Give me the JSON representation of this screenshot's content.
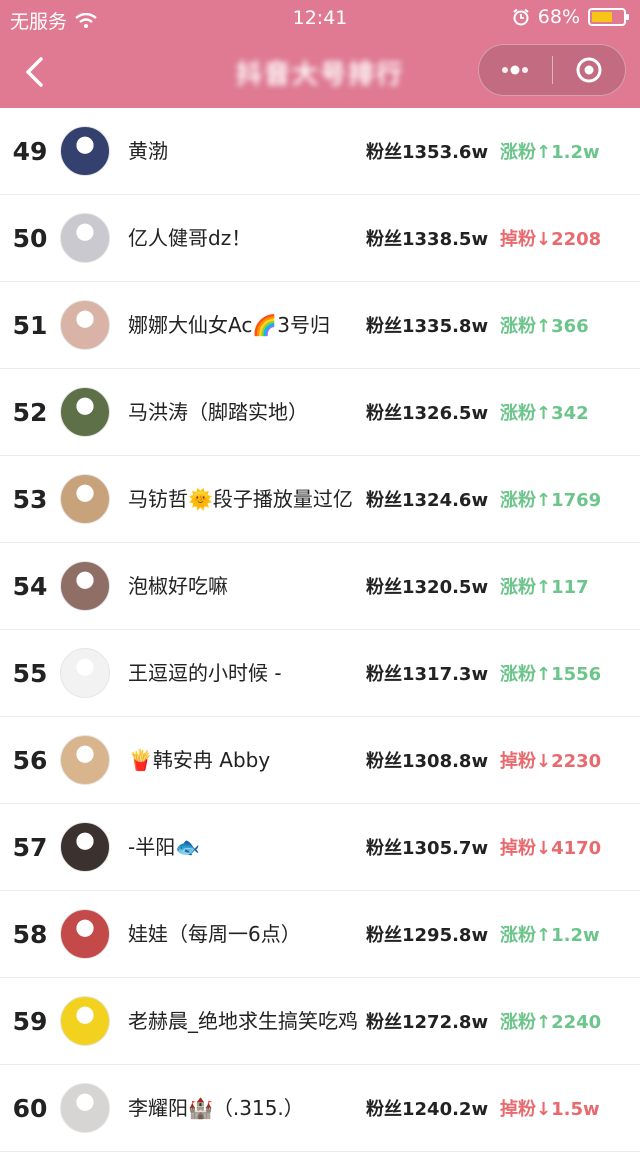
{
  "status": {
    "carrier": "无服务",
    "time": "12:41",
    "battery": "68%"
  },
  "nav": {
    "title": "抖音大号排行",
    "back_icon": "chevron-left-icon"
  },
  "colors": {
    "header": "#df7a92",
    "up": "#6cc58a",
    "down": "#e96a6e"
  },
  "rows": [
    {
      "rank": "49",
      "name": "黄渤",
      "fans": "粉丝1353.6w",
      "change": "涨粉↑1.2w",
      "dir": "up",
      "avatar": "#34406e"
    },
    {
      "rank": "50",
      "name": "亿人健哥dz！",
      "fans": "粉丝1338.5w",
      "change": "掉粉↓2208",
      "dir": "down",
      "avatar": "#c9c9cf"
    },
    {
      "rank": "51",
      "name": "娜娜大仙女Ac🌈3号归",
      "fans": "粉丝1335.8w",
      "change": "涨粉↑366",
      "dir": "up",
      "avatar": "#d8b3a6"
    },
    {
      "rank": "52",
      "name": "马洪涛（脚踏实地）",
      "fans": "粉丝1326.5w",
      "change": "涨粉↑342",
      "dir": "up",
      "avatar": "#5e7048"
    },
    {
      "rank": "53",
      "name": "马钫哲🌞段子播放量过亿",
      "fans": "粉丝1324.6w",
      "change": "涨粉↑1769",
      "dir": "up",
      "avatar": "#c7a27a"
    },
    {
      "rank": "54",
      "name": "泡椒好吃嘛",
      "fans": "粉丝1320.5w",
      "change": "涨粉↑117",
      "dir": "up",
      "avatar": "#8f6e66"
    },
    {
      "rank": "55",
      "name": "王逗逗的小时候 -",
      "fans": "粉丝1317.3w",
      "change": "涨粉↑1556",
      "dir": "up",
      "avatar": "#f2f2f2"
    },
    {
      "rank": "56",
      "name": "🍟韩安冉 Abby",
      "fans": "粉丝1308.8w",
      "change": "掉粉↓2230",
      "dir": "down",
      "avatar": "#d9b58d"
    },
    {
      "rank": "57",
      "name": "-半阳🐟",
      "fans": "粉丝1305.7w",
      "change": "掉粉↓4170",
      "dir": "down",
      "avatar": "#3b3230"
    },
    {
      "rank": "58",
      "name": "娃娃（每周一6点）",
      "fans": "粉丝1295.8w",
      "change": "涨粉↑1.2w",
      "dir": "up",
      "avatar": "#c44a4a"
    },
    {
      "rank": "59",
      "name": "老赫晨_绝地求生搞笑吃鸡",
      "fans": "粉丝1272.8w",
      "change": "涨粉↑2240",
      "dir": "up",
      "avatar": "#f2d21e"
    },
    {
      "rank": "60",
      "name": "李耀阳🏰（.315.）",
      "fans": "粉丝1240.2w",
      "change": "掉粉↓1.5w",
      "dir": "down",
      "avatar": "#d7d4d4"
    }
  ]
}
